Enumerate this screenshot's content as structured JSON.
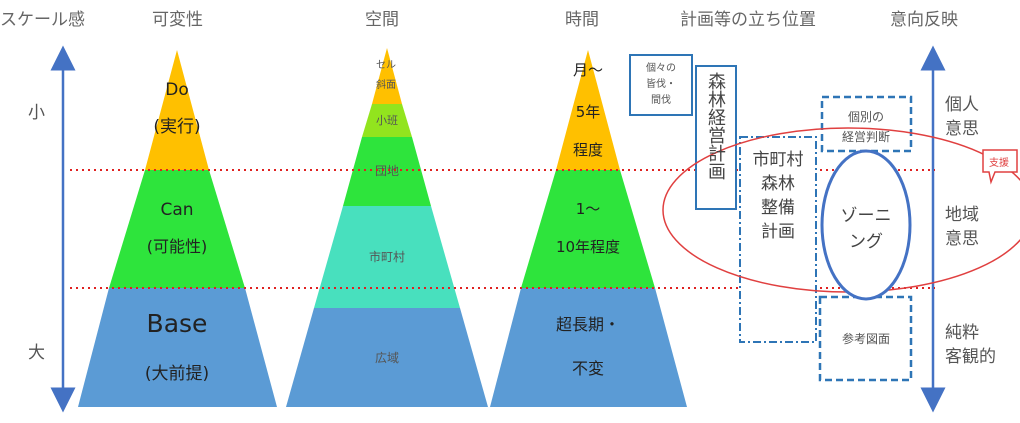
{
  "headers": {
    "scale": "スケール感",
    "variability": "可変性",
    "space": "空間",
    "time": "時間",
    "plan_position": "計画等の立ち位置",
    "intent": "意向反映"
  },
  "axis": {
    "small": "小",
    "large": "大"
  },
  "variability_levels": {
    "do_title": "Do",
    "do_sub": "(実行)",
    "can_title": "Can",
    "can_sub": "(可能性)",
    "base_title": "Base",
    "base_sub": "(大前提)"
  },
  "space_levels": {
    "cell_line1": "セル",
    "cell_line2": "斜面",
    "subcompartment": "小班",
    "block": "団地",
    "municipality": "市町村",
    "wide_area": "広域"
  },
  "time_levels": {
    "top_line1": "月～",
    "top_line2": "5年",
    "top_line3": "程度",
    "mid_line1": "1～",
    "mid_line2": "10年程度",
    "base_line1": "超長期・",
    "base_line2": "不変"
  },
  "plans": {
    "individual_harvest_line1": "個々の",
    "individual_harvest_line2": "皆伐・",
    "individual_harvest_line3": "間伐",
    "forest_management_plan": "森林経営計画",
    "municipal_plan_line1": "市町村",
    "municipal_plan_line2": "森林",
    "municipal_plan_line3": "整備",
    "municipal_plan_line4": "計画",
    "individual_judgment_line1": "個別の",
    "individual_judgment_line2": "経営判断",
    "zoning_line1": "ゾーニ",
    "zoning_line2": "ング",
    "reference_map": "参考図面",
    "support": "支援"
  },
  "intent_levels": {
    "personal_line1": "個人",
    "personal_line2": "意思",
    "regional_line1": "地域",
    "regional_line2": "意思",
    "pure_line1": "純粋",
    "pure_line2": "客観的"
  },
  "colors": {
    "do": "#ffc000",
    "can": "#2ee43c",
    "base": "#5b9bd5",
    "subcompartment": "#92e41e",
    "municipality": "#48e0be",
    "axis_arrow": "#4472c4",
    "divider": "#e02020",
    "box_border": "#2e75b6",
    "callout": "#e04040"
  }
}
